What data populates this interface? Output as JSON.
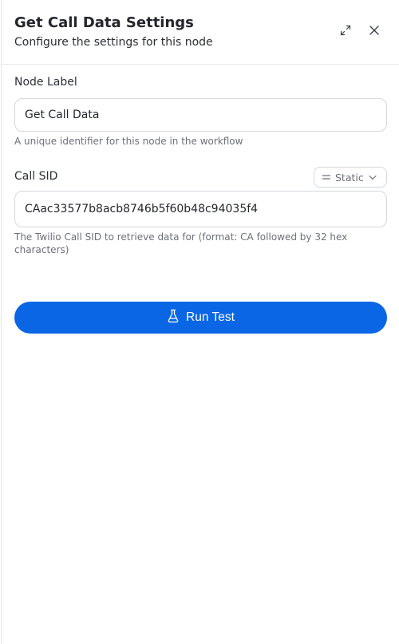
{
  "header": {
    "title": "Get Call Data Settings",
    "subtitle": "Configure the settings for this node",
    "expand_icon": "expand-diagonal-icon",
    "close_icon": "close-x-icon"
  },
  "fields": {
    "node_label": {
      "label": "Node Label",
      "value": "Get Call Data",
      "help": "A unique identifier for this node in the workflow"
    },
    "call_sid": {
      "label": "Call SID",
      "value": "CAac33577b8acb8746b5f60b48c94035f4",
      "help": "The Twilio Call SID to retrieve data for (format: CA followed by 32 hex characters)",
      "mode": "Static",
      "mode_icon": "equals-lines-icon",
      "mode_chevron": "chevron-down-icon"
    }
  },
  "actions": {
    "run_test_label": "Run Test",
    "run_test_icon": "flask-icon"
  },
  "colors": {
    "primary": "#0a66e4",
    "text": "#23262b",
    "muted": "#6b7079",
    "border": "#d5d8dc"
  }
}
